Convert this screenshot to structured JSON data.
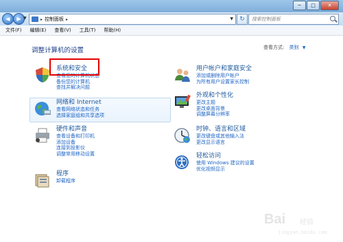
{
  "address": {
    "crumb": "控制面板",
    "sep": "▸"
  },
  "search": {
    "placeholder": "搜索控制面板"
  },
  "window_buttons": {
    "minimize": "─",
    "maximize": "□",
    "close": "✕"
  },
  "menu": [
    "文件(F)",
    "编辑(E)",
    "查看(V)",
    "工具(T)",
    "帮助(H)"
  ],
  "main": {
    "heading": "调整计算机的设置",
    "view_by_label": "查看方式:",
    "view_by_value": "类别",
    "view_by_arrow": "▼"
  },
  "categories": [
    {
      "title": "系统和安全",
      "links": [
        "查看您的计算机状态",
        "备份您的计算机",
        "查找并解决问题"
      ]
    },
    {
      "title": "网络和 Internet",
      "links": [
        "查看网络状态和任务",
        "选择家庭组和共享选项"
      ]
    },
    {
      "title": "硬件和声音",
      "links": [
        "查看设备和打印机",
        "添加设备",
        "连接到投影仪",
        "调整常用移动设置"
      ]
    },
    {
      "title": "程序",
      "links": [
        "卸载程序"
      ]
    },
    {
      "title": "用户帐户和家庭安全",
      "links": [
        "添加或删除用户帐户",
        "为所有用户设置家长控制"
      ]
    },
    {
      "title": "外观和个性化",
      "links": [
        "更改主题",
        "更改桌面背景",
        "调整屏幕分辨率"
      ]
    },
    {
      "title": "时钟、语言和区域",
      "links": [
        "更改键盘或其他输入法",
        "更改显示语言"
      ]
    },
    {
      "title": "轻松访问",
      "links": [
        "使用 Windows 建议的设置",
        "优化视频显示"
      ]
    }
  ],
  "watermark": {
    "brand": "Bai",
    "word": "经验",
    "url": "jingyan.baidu.com"
  },
  "colors": {
    "link": "#1f66c4",
    "category_title": "#1f5a9e",
    "highlight": "#e30000"
  }
}
